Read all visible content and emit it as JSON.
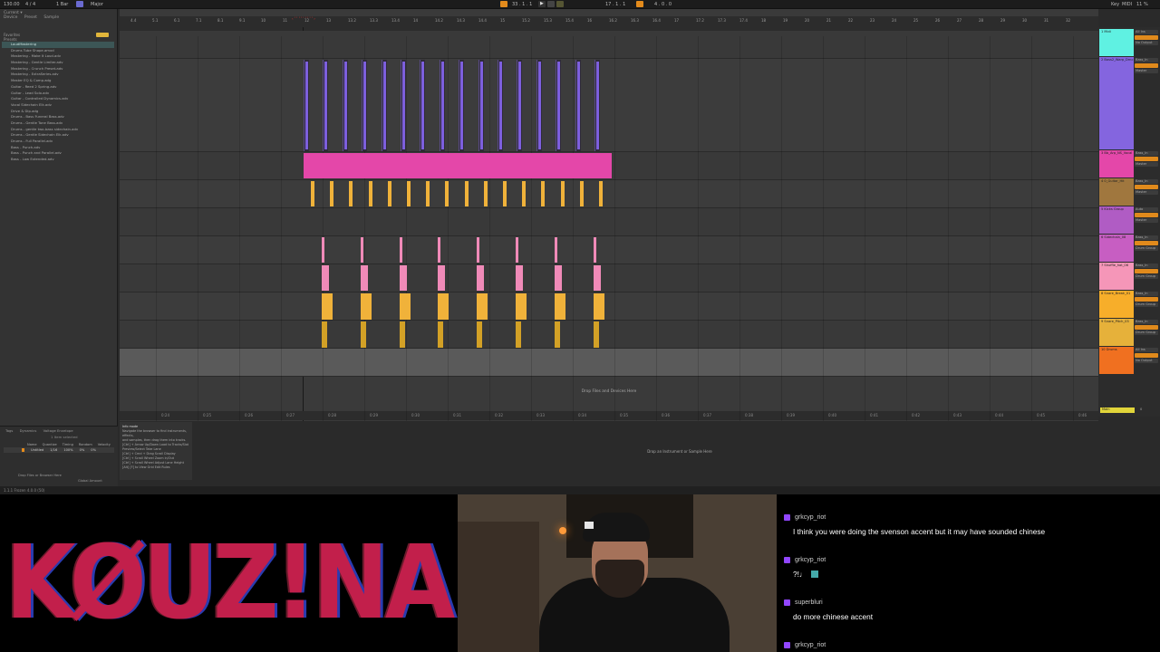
{
  "control_bar": {
    "tempo": "130.00",
    "time_sig": "4 / 4",
    "bars": "1 Bar",
    "key": "Major",
    "position": "33 . 1 . 1",
    "loop_start": "17 . 1 . 1",
    "loop_length": "4 . 0 . 0",
    "cpu": "Key",
    "midi": "MIDI",
    "cpu_meter": "11 %"
  },
  "browser": {
    "header": "Current ▾",
    "tabs": [
      "Device",
      "Preset",
      "Sample"
    ],
    "section": "Favorites",
    "collection_label": "Presets",
    "items": [
      "LoudMastering",
      "Drums Tube Shape.amxd",
      "Mastering - Make It Loud.adv",
      "Mastering - Gentle Limiter.adv",
      "Mastering - Crunch Preset.adv",
      "Mastering - ExtraSeries.adv",
      "Master EQ & Comp.adg",
      "Guitar - Reed 2 Spring.adv",
      "Guitar - Lead Solo.adv",
      "Guitar - Controlled Dynamics.adv",
      "Vocal Sidechain Elk.adv",
      "Drive & Dip.adg",
      "Drums - Bass Funeral Bass.adv",
      "Drums - Gentle Tone Bass.adv",
      "Drums - gentle two-bass sidechain.adv",
      "Drums - Gentle Sidechain Elk.adv",
      "Drums - Full Parallel.adv",
      "Bass - Punch.adv",
      "Bass - Punch and Parallel.adv",
      "Bass - Low Extended.adv"
    ]
  },
  "detail": {
    "tabs": [
      "Tags",
      "Dynamics",
      "Voltage Envelope"
    ],
    "clip_label": "1 Item selected",
    "columns": [
      "Name",
      "Quantize",
      "Timing",
      "Random",
      "Velocity"
    ],
    "row_values": [
      "Untitled",
      "1/16",
      "100%",
      "0%",
      "0%"
    ],
    "footer_left": "Drop Files or Browser Here",
    "footer_right": "Global Amount"
  },
  "info_panel": {
    "title": "Info mode",
    "lines": [
      "Navigate the browser to find instruments, effects,",
      "and samples, then drag them into tracks.",
      "[Ctrl] + Arrow Up/Down Load to Tracks/Slot",
      "Preview/Select Take Lane",
      "[Ctrl] + Cmd + Drag Scroll Display",
      "[Ctrl] + Scroll Wheel Zoom in/Out",
      "[Ctrl] + Scroll Wheel Adjust Lane Height",
      "[Alt] [F] to View Grid Edit Rules"
    ]
  },
  "arrangement": {
    "ruler_ticks": [
      "4.4",
      "5.1",
      "6.1",
      "7.1",
      "8.1",
      "9.1",
      "10",
      "11",
      "12",
      "13",
      "13.2",
      "13.3",
      "13.4",
      "14",
      "14.2",
      "14.3",
      "14.4",
      "15",
      "15.2",
      "15.3",
      "15.4",
      "16",
      "16.2",
      "16.3",
      "16.4",
      "17",
      "17.2",
      "17.3",
      "17.4",
      "18",
      "19",
      "20",
      "21",
      "22",
      "23",
      "24",
      "25",
      "26",
      "27",
      "28",
      "29",
      "30",
      "31",
      "32"
    ],
    "bottom_ticks": [
      "0:24",
      "0:25",
      "0:26",
      "0:27",
      "0:28",
      "0:29",
      "0:30",
      "0:31",
      "0:32",
      "0:33",
      "0:34",
      "0:35",
      "0:36",
      "0:37",
      "0:38",
      "0:39",
      "0:40",
      "0:41",
      "0:42",
      "0:43",
      "0:44",
      "0:45",
      "0:46",
      "0:47"
    ],
    "drop_hint": "Drop Files and Devices Here",
    "pink_clip_name": "Bb_Arp_NS_Vocal_Chops"
  },
  "drop_instrument_hint": "Drop an Instrument or Sample Here",
  "mixer_tracks": [
    {
      "label": "1 Midi",
      "color": "#5ff1e2",
      "output": "All Ins",
      "sends": "No Output"
    },
    {
      "label": "2 Bass2_Warp_Drnc",
      "color": "#8465df",
      "output": "Bass_In",
      "sends": "Master"
    },
    {
      "label": "3 Bb_Arp_NS_Vocal",
      "color": "#e447a9",
      "output": "Bass_In",
      "sends": "Master"
    },
    {
      "label": "4 0_Guitar_Hit",
      "color": "#a0773e",
      "output": "Bass_In",
      "sends": "Master"
    },
    {
      "label": "5 Kicks Group",
      "color": "#b05cc4",
      "output": "Auto",
      "sends": "Master"
    },
    {
      "label": "6 Sidechain_08",
      "color": "#c75ec2",
      "output": "Bass_In",
      "sends": "Drum Group"
    },
    {
      "label": "7 Shuffle_hat_06",
      "color": "#f596b8",
      "output": "Bass_In",
      "sends": "Drum Group"
    },
    {
      "label": "8 Snare_Break_01",
      "color": "#f7ae2a",
      "output": "Bass_In",
      "sends": "Drum Group"
    },
    {
      "label": "9 Snare_Pitch_03",
      "color": "#e6b13a",
      "output": "Bass_In",
      "sends": "Drum Group"
    },
    {
      "label": "10 Drums",
      "color": "#f07020",
      "output": "All Ins",
      "sends": "No Output"
    }
  ],
  "master": {
    "label": "Main",
    "value": "0"
  },
  "status_bar": "1.1.1 Frozen 4.0.0 (50)",
  "logo_text": "KØUZ!NA",
  "chat": [
    {
      "user": "grkcyp_riot",
      "text": "I think you were doing the svenson accent but it may have sounded chinese"
    },
    {
      "user": "grkcyp_riot",
      "text": "?!♩"
    },
    {
      "user": "superbluri",
      "text": "do more chinese accent"
    },
    {
      "user": "grkcyp_riot",
      "text": ""
    }
  ],
  "colors": {
    "purple": "#7d5fde",
    "pink": "#e447a9",
    "amber": "#f0b23a",
    "orange": "#e38b1c",
    "twitch": "#9146ff"
  }
}
